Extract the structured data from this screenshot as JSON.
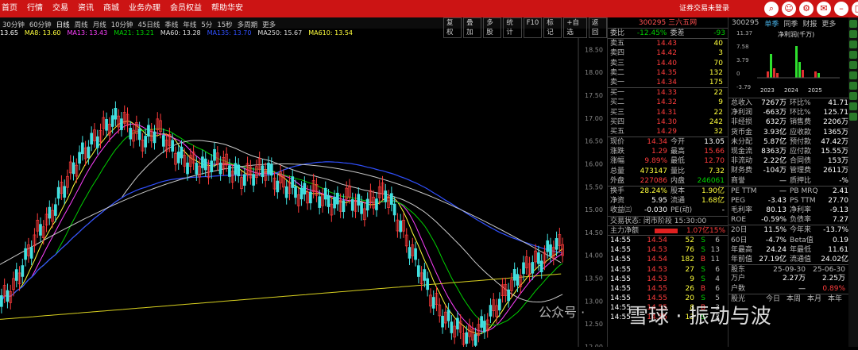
{
  "topbar": {
    "menu": [
      "首页",
      "行情",
      "交易",
      "资讯",
      "商城",
      "业务办理",
      "会员权益",
      "帮助华安"
    ],
    "status": "证券交易未登录",
    "icons": [
      "search-icon",
      "user-icon",
      "gear-icon",
      "message-icon",
      "minimize-icon",
      "maximize-icon",
      "close-icon"
    ]
  },
  "timeframes": {
    "items": [
      "30分钟",
      "60分钟",
      "日线",
      "周线",
      "月线",
      "10分钟",
      "45日线",
      "季线",
      "年线",
      "5分",
      "15秒",
      "多周期",
      "更多"
    ],
    "active": "日线",
    "tools": [
      "复权",
      "叠加",
      "多股",
      "统计",
      "F10",
      "标记",
      "+自选",
      "返回"
    ]
  },
  "ma_bar": [
    {
      "label": "13.65",
      "color": "#ffffff"
    },
    {
      "label": "MA8: 13.60",
      "color": "#ffff3c"
    },
    {
      "label": "MA13: 13.43",
      "color": "#ff40ff"
    },
    {
      "label": "MA21: 13.21",
      "color": "#00d000"
    },
    {
      "label": "MA60: 13.28",
      "color": "#dddddd"
    },
    {
      "label": "MA135: 13.70",
      "color": "#3050ff"
    },
    {
      "label": "MA250: 15.67",
      "color": "#dddddd"
    },
    {
      "label": "MA610: 13.54",
      "color": "#ffff3c"
    }
  ],
  "chart_data": {
    "type": "candlestick",
    "price_axis": [
      "18.50",
      "18.00",
      "17.50",
      "17.00",
      "16.50",
      "16.00",
      "15.50",
      "15.00",
      "14.50",
      "14.00",
      "13.50",
      "13.00",
      "12.50",
      "12.00"
    ],
    "ylim": [
      12.0,
      18.75
    ]
  },
  "quote": {
    "title": "300295 三六五网",
    "weibi": {
      "label": "委比",
      "value": "-12.45%",
      "label2": "委差",
      "value2": "-93"
    },
    "asks": [
      {
        "label": "卖五",
        "price": "14.43",
        "vol": "40"
      },
      {
        "label": "卖四",
        "price": "14.42",
        "vol": "3"
      },
      {
        "label": "卖三",
        "price": "14.40",
        "vol": "70"
      },
      {
        "label": "卖二",
        "price": "14.35",
        "vol": "132"
      },
      {
        "label": "卖一",
        "price": "14.34",
        "vol": "175"
      }
    ],
    "bids": [
      {
        "label": "买一",
        "price": "14.33",
        "vol": "22"
      },
      {
        "label": "买二",
        "price": "14.32",
        "vol": "9"
      },
      {
        "label": "买三",
        "price": "14.31",
        "vol": "22"
      },
      {
        "label": "买四",
        "price": "14.30",
        "vol": "242"
      },
      {
        "label": "买五",
        "price": "14.29",
        "vol": "32"
      }
    ],
    "stats": [
      [
        "现价",
        "14.34",
        "今开",
        "13.05"
      ],
      [
        "涨跌",
        "1.29",
        "最高",
        "15.66"
      ],
      [
        "涨幅",
        "9.89%",
        "最低",
        "12.70"
      ],
      [
        "总量",
        "473147",
        "量比",
        "7.32"
      ],
      [
        "外盘",
        "227086",
        "内盘",
        "246061"
      ]
    ],
    "stats2": [
      [
        "换手",
        "28.24%",
        "股本",
        "1.90亿"
      ],
      [
        "净资",
        "5.95",
        "流通",
        "1.68亿"
      ],
      [
        "收益㈢",
        "-0.030",
        "PE(动)",
        "-"
      ]
    ],
    "trade_status": "交易状态: 闭市阶段 15:30:00",
    "main_flow": {
      "label": "主力净额",
      "value": "1.07亿",
      "pct": "15%"
    },
    "ticks": [
      [
        "14:55",
        "14.54",
        "52",
        "S",
        "6"
      ],
      [
        "14:55",
        "14.53",
        "76",
        "S",
        "13"
      ],
      [
        "14:55",
        "14.54",
        "182",
        "B",
        "11"
      ],
      [
        "14:55",
        "14.53",
        "27",
        "S",
        "6"
      ],
      [
        "14:55",
        "14.53",
        "9",
        "S",
        "4"
      ],
      [
        "14:55",
        "14.55",
        "26",
        "B",
        "6"
      ],
      [
        "14:55",
        "14.55",
        "20",
        "S",
        "5"
      ],
      [
        "14:55",
        "14.55",
        "8",
        "B",
        "3"
      ],
      [
        "14:55",
        "14.55",
        "13",
        "S",
        "2"
      ]
    ]
  },
  "finance": {
    "code": "300295",
    "tabs": [
      "单季",
      "同季",
      "财报",
      "更多"
    ],
    "chart_label": "净利润(千万)",
    "y_ticks": [
      "11.37",
      "7.58",
      "3.79",
      "0",
      "-3.79"
    ],
    "years": [
      "2023",
      "2024",
      "2025"
    ],
    "rows": [
      [
        "总收入",
        "7267万",
        "环比%",
        "41.71"
      ],
      [
        "净利润",
        "-663万",
        "环比%",
        "125.71"
      ],
      [
        "非经损",
        "632万",
        "销售费",
        "2206万"
      ],
      [
        "货币金",
        "3.93亿",
        "应收款",
        "1365万"
      ],
      [
        "未分配",
        "5.87亿",
        "预付款",
        "47.42万"
      ],
      [
        "现金流",
        "8363万",
        "应付款",
        "15.55万"
      ],
      [
        "非流动",
        "2.22亿",
        "合同债",
        "153万"
      ],
      [
        "财务费",
        "-104万",
        "管理费",
        "2611万"
      ],
      [
        "商誉",
        "—",
        "质押比",
        "-%"
      ]
    ],
    "rows2": [
      [
        "PE TTM",
        "—",
        "PB MRQ",
        "2.41"
      ],
      [
        "PEG",
        "-3.43",
        "PS TTM",
        "27.70"
      ],
      [
        "毛利率",
        "80.13",
        "净利率",
        "-9.13"
      ],
      [
        "ROE",
        "-0.59%",
        "负债率",
        "7.27"
      ]
    ],
    "rows3": [
      [
        "20日",
        "11.5%",
        "今年来",
        "-13.7%"
      ],
      [
        "60日",
        "-4.7%",
        "Beta值",
        "0.19"
      ],
      [
        "年最高",
        "24.24",
        "年最低",
        "11.61"
      ],
      [
        "年前值",
        "27.19亿",
        "流通值",
        "24.02亿"
      ]
    ],
    "holders": {
      "label": "股东",
      "d1": "25-09-30",
      "d2": "25-06-30"
    },
    "holders_row": [
      "万户",
      "2.27万",
      "2.25万"
    ],
    "holders_row2": [
      "户数",
      "—",
      "0.89%"
    ],
    "bottom": {
      "label": "股光",
      "tabs": [
        "今日",
        "本周",
        "本月",
        "本年"
      ]
    }
  },
  "watermark": {
    "prefix": "公众号 · ",
    "text": "雪球 · 振动与波"
  }
}
